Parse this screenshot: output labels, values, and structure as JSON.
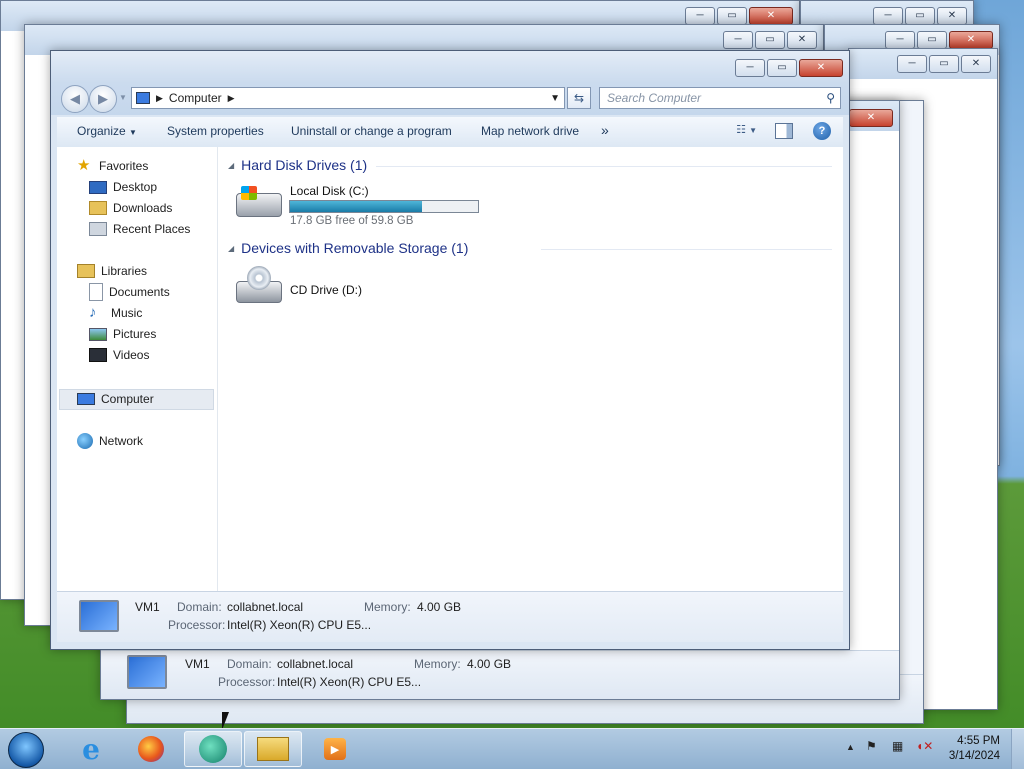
{
  "window": {
    "address_location": "Computer",
    "search_placeholder": "Search Computer",
    "caption_minimize": "─",
    "caption_maximize": "▭",
    "caption_close": "✕"
  },
  "toolbar": {
    "organize": "Organize",
    "system_properties": "System properties",
    "uninstall": "Uninstall or change a program",
    "map_drive": "Map network drive",
    "overflow": "»"
  },
  "nav": {
    "favorites": "Favorites",
    "desktop": "Desktop",
    "downloads": "Downloads",
    "recent_places": "Recent Places",
    "libraries": "Libraries",
    "documents": "Documents",
    "music": "Music",
    "pictures": "Pictures",
    "videos": "Videos",
    "computer": "Computer",
    "network": "Network"
  },
  "groups": {
    "hard_disks": "Hard Disk Drives (1)",
    "removable": "Devices with Removable Storage (1)"
  },
  "drives": {
    "c_name": "Local Disk (C:)",
    "c_free": "17.8 GB free of 59.8 GB",
    "c_used_fraction": 0.702,
    "d_name": "CD Drive (D:)"
  },
  "details": {
    "name": "VM1",
    "domain_label": "Domain:",
    "domain_value": "collabnet.local",
    "memory_label": "Memory:",
    "memory_value": "4.00 GB",
    "processor_label": "Processor:",
    "processor_value": "Intel(R) Xeon(R) CPU E5..."
  },
  "background_details": {
    "name": "VM1",
    "domain_label": "Domain:",
    "domain_value": "collabnet.local",
    "memory_label": "Memory:",
    "memory_value": "4.00 GB",
    "processor_label": "Processor:",
    "processor_value": "Intel(R) Xeon(R) CPU E5..."
  },
  "taskbar": {
    "time": "4:55 PM",
    "date": "3/14/2024",
    "apps": [
      "start-orb",
      "internet-explorer",
      "firefox",
      "media-app",
      "windows-explorer",
      "media-player"
    ]
  },
  "colors": {
    "group_header": "#1e3287",
    "capacity_bar": "#1a7ca8"
  }
}
